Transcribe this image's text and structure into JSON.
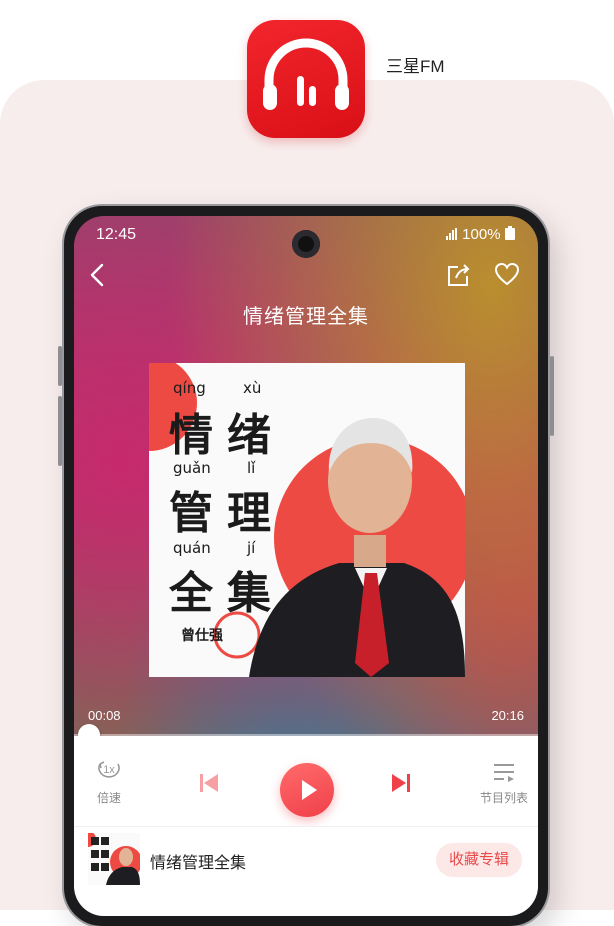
{
  "app": {
    "name": "三星FM",
    "icon": "headphones-icon",
    "brand_color": "#e8151d"
  },
  "status_bar": {
    "time": "12:45",
    "battery": "100%"
  },
  "player": {
    "title": "情绪管理全集",
    "cover": {
      "pinyin": [
        "qíng",
        "xù",
        "guǎn",
        "lǐ",
        "quán",
        "jí"
      ],
      "chars": [
        "情",
        "绪",
        "管",
        "理",
        "全",
        "集"
      ],
      "author": "曾仕强"
    },
    "current_time": "00:08",
    "total_time": "20:16",
    "progress": 0.01,
    "speed_icon_text": "1x",
    "speed_label": "倍速",
    "playlist_label": "节目列表",
    "accent_color": "#f0404a"
  },
  "album_bar": {
    "title": "情绪管理全集",
    "favorite_button": "收藏专辑"
  }
}
